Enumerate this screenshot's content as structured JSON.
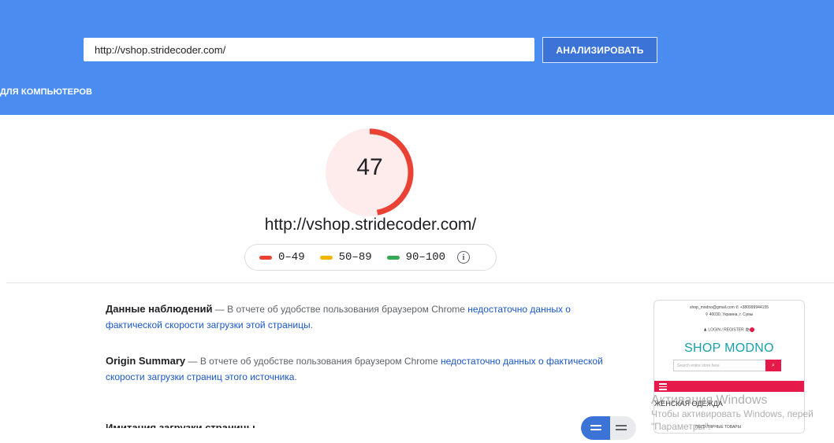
{
  "header": {
    "url_value": "http://vshop.stridecoder.com/",
    "analyze_label": "АНАЛИЗИРОВАТЬ",
    "tab_desktop": "ДЛЯ КОМПЬЮТЕРОВ",
    "color": "#4a8cf0"
  },
  "score": {
    "value": "47",
    "fraction": 0.47,
    "color": "#e94235",
    "url": "http://vshop.stridecoder.com/"
  },
  "legend": [
    {
      "label": "0–49",
      "color": "#e94235"
    },
    {
      "label": "50–89",
      "color": "#f4b400"
    },
    {
      "label": "90–100",
      "color": "#34a853"
    }
  ],
  "field_data": {
    "title": "Данные наблюдений",
    "sep": " — ",
    "text": "В отчете об удобстве пользования браузером Chrome ",
    "link": "недостаточно данных о фактической скорости загрузки этой страницы",
    "end": "."
  },
  "origin_summary": {
    "title": "Origin Summary",
    "sep": " — ",
    "text": "В отчете об удобстве пользования браузером Chrome ",
    "link": "недостаточно данных о фактической скорости загрузки страниц этого источника",
    "end": "."
  },
  "lab_heading": "Имитация загрузки страницы",
  "thumbnail": {
    "contact": "shop_modno@gmail.com  ✆ +380999944155",
    "address": "⚲ 40030, Украина, г. Сумы",
    "login": "♟ LOGIN / REGISTER",
    "logo": "SHOP MODNO",
    "search_placeholder": "Search entire store here",
    "search_icon": "search-icon",
    "category": "ЖЕНСКАЯ ОДЕЖДА",
    "popular": "ПОПУЛЯРНЫЕ ТОВАРЫ"
  },
  "watermark": {
    "line1": "Активация Windows",
    "line2": "Чтобы активировать Windows, перей",
    "line3": "\"Параметры\"."
  }
}
